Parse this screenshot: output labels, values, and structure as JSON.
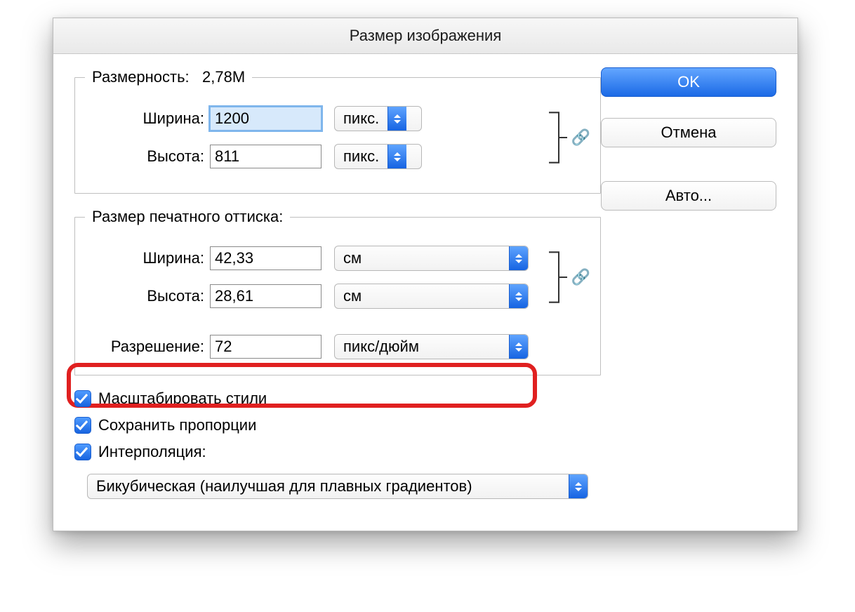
{
  "dialog_title": "Размер изображения",
  "pixel_dimensions": {
    "legend_prefix": "Размерность:",
    "size_value": "2,78M",
    "width_label": "Ширина:",
    "width_value": "1200",
    "width_unit": "пикс.",
    "height_label": "Высота:",
    "height_value": "811",
    "height_unit": "пикс.",
    "link_icon": "🔗"
  },
  "print_size": {
    "legend": "Размер печатного оттиска:",
    "width_label": "Ширина:",
    "width_value": "42,33",
    "width_unit": "см",
    "height_label": "Высота:",
    "height_value": "28,61",
    "height_unit": "см",
    "resolution_label": "Разрешение:",
    "resolution_value": "72",
    "resolution_unit": "пикс/дюйм",
    "link_icon": "🔗"
  },
  "checks": {
    "scale_styles": "Масштабировать стили",
    "keep_proportions": "Сохранить пропорции",
    "interpolation": "Интерполяция:"
  },
  "interpolation_method": "Бикубическая (наилучшая для плавных градиентов)",
  "buttons": {
    "ok": "OK",
    "cancel": "Отмена",
    "auto": "Авто..."
  }
}
